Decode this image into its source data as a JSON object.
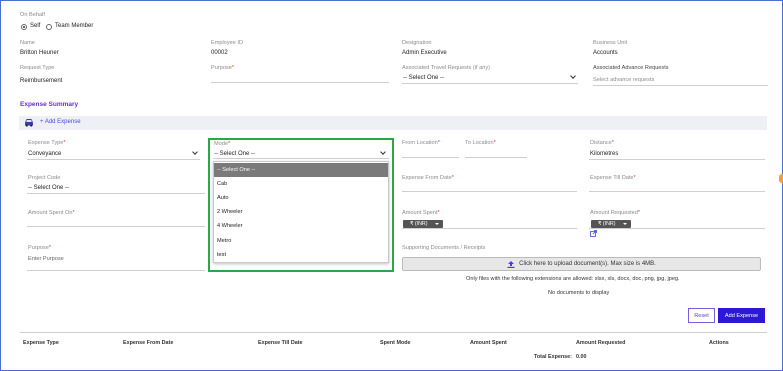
{
  "on_behalf": {
    "label": "On Behalf",
    "options": [
      {
        "label": "Self",
        "selected": true
      },
      {
        "label": "Team Member",
        "selected": false
      }
    ]
  },
  "employee": {
    "name_label": "Name",
    "name_value": "Britton Heuner",
    "id_label": "Employee ID",
    "id_value": "00002",
    "designation_label": "Designation",
    "designation_value": "Admin Executive",
    "business_unit_label": "Business Unit",
    "business_unit_value": "Accounts"
  },
  "request": {
    "type_label": "Request Type",
    "type_value": "Reimbursement",
    "purpose_label": "Purpose",
    "travel_label": "Associated Travel Requests (if any)",
    "travel_value": "-- Select One --",
    "advance_label": "Associated Advance Requests",
    "advance_placeholder": "Select advance requests"
  },
  "expense_summary": {
    "title": "Expense Summary",
    "add_expense_label": "+ Add Expense"
  },
  "form": {
    "expense_type_label": "Expense Type",
    "expense_type_value": "Conveyance",
    "mode_label": "Mode",
    "mode_value": "-- Select One --",
    "from_location_label": "From Location",
    "to_location_label": "To Location",
    "distance_label": "Distance",
    "distance_value": "Kilometres",
    "project_code_label": "Project Code",
    "project_code_value": "-- Select One --",
    "expense_from_label": "Expense From Date",
    "expense_till_label": "Expense Till Date",
    "amount_spent_on_label": "Amount Spent On",
    "amount_spent_label": "Amount Spent",
    "amount_spent_currency": "₹ (INR)",
    "amount_requested_label": "Amount Requested",
    "amount_requested_currency": "₹ (INR)",
    "purpose_label": "Purpose",
    "purpose_placeholder": "Enter Purpose",
    "supporting_docs_label": "Supporting Documents / Receipts",
    "upload_label": "Click here to upload document(s). Max size is 4MB.",
    "allowed_ext": "Only files with the following extensions are allowed: xlsx, xls, docx, doc, png, jpg, jpeg.",
    "no_docs": "No documents to display"
  },
  "mode_dropdown": {
    "options": [
      "-- Select One --",
      "Cab",
      "Auto",
      "2 Wheeler",
      "4 Wheeler",
      "Metro",
      "test"
    ],
    "highlighted_index": 0
  },
  "buttons": {
    "reset": "Reset",
    "add_expense": "Add Expense"
  },
  "table": {
    "headers": [
      "Expense Type",
      "Expense From Date",
      "Expense Till Date",
      "Spent Mode",
      "Amount Spent",
      "Amount Requested",
      "Actions"
    ],
    "total_label": "Total Expense:",
    "total_value": "0.00"
  },
  "colors": {
    "accent": "#6a2fd6",
    "primary_button": "#2b19d6",
    "highlight_border": "#2aa845",
    "required": "#e53935"
  }
}
